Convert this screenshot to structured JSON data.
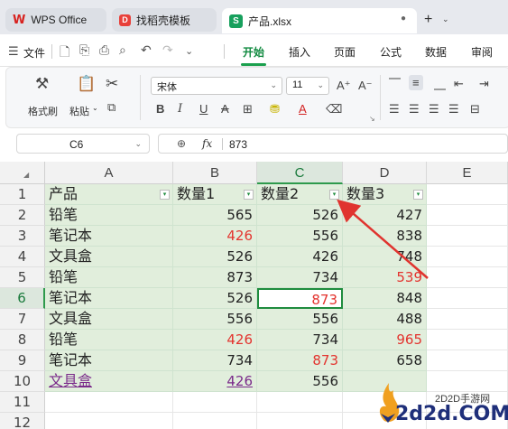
{
  "titlebar": {
    "tabs": [
      {
        "label": "WPS Office",
        "icon": "wps-logo-icon"
      },
      {
        "label": "找稻壳模板",
        "icon": "docer-logo-icon"
      },
      {
        "label": "产品.xlsx",
        "icon": "spreadsheet-logo-icon"
      }
    ],
    "new_tab": "+"
  },
  "menubar": {
    "file_label": "文件",
    "tabs": [
      "开始",
      "插入",
      "页面",
      "公式",
      "数据",
      "审阅"
    ],
    "active_tab": "开始"
  },
  "ribbon": {
    "format_painter": "格式刷",
    "paste": "粘贴",
    "font_name": "宋体",
    "font_size": "11",
    "bold": "B",
    "italic": "I",
    "underline": "U",
    "strike": "A"
  },
  "formula_bar": {
    "cell_ref": "C6",
    "fx": "fx",
    "value": "873"
  },
  "columns": [
    "A",
    "B",
    "C",
    "D",
    "E"
  ],
  "rows": [
    "1",
    "2",
    "3",
    "4",
    "5",
    "6",
    "7",
    "8",
    "9",
    "10",
    "11",
    "12"
  ],
  "sheet": {
    "header": [
      "产品",
      "数量1",
      "数量2",
      "数量3"
    ],
    "data": [
      [
        "铅笔",
        "565",
        "526",
        "427"
      ],
      [
        "笔记本",
        "426",
        "556",
        "838"
      ],
      [
        "文具盒",
        "526",
        "426",
        "748"
      ],
      [
        "铅笔",
        "873",
        "734",
        "539"
      ],
      [
        "笔记本",
        "526",
        "873",
        "848"
      ],
      [
        "文具盒",
        "556",
        "556",
        "488"
      ],
      [
        "铅笔",
        "426",
        "734",
        "965"
      ],
      [
        "笔记本",
        "734",
        "873",
        "658"
      ],
      [
        "文具盒",
        "426",
        "556",
        ""
      ]
    ],
    "red_color": "#e3342f",
    "fill_color": "#e1eedc"
  },
  "watermark": {
    "small": "2D2D手游网",
    "big": "2d2d.COM"
  }
}
